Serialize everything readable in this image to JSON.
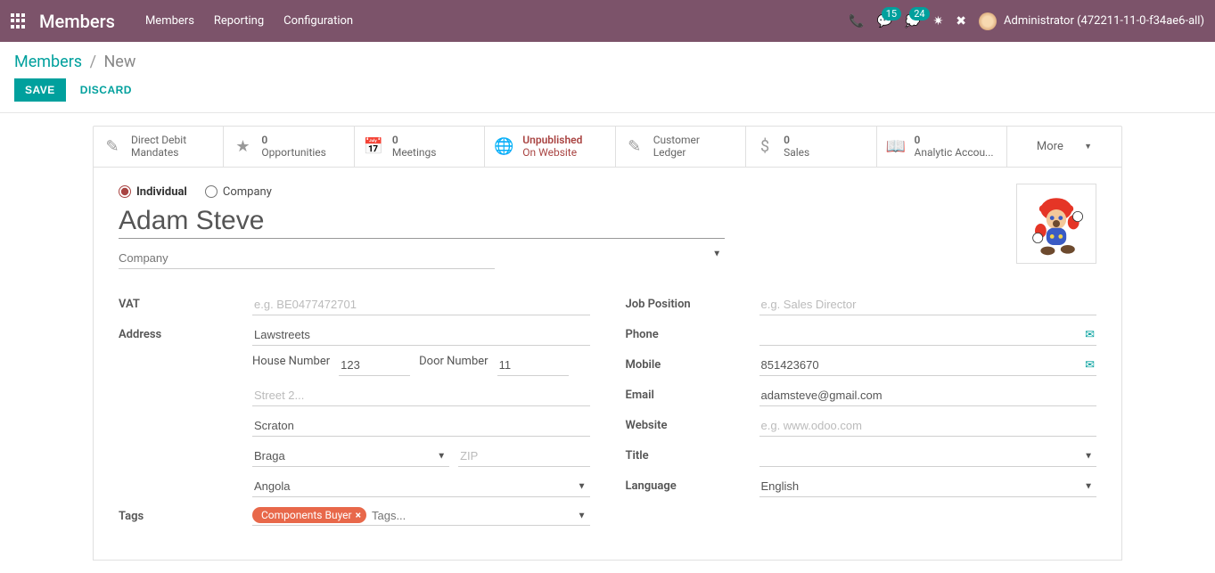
{
  "topbar": {
    "brand": "Members",
    "menu": [
      "Members",
      "Reporting",
      "Configuration"
    ],
    "badges": {
      "msgs": "15",
      "chats": "24"
    },
    "user": "Administrator (472211-11-0-f34ae6-all)"
  },
  "breadcrumb": {
    "root": "Members",
    "current": "New"
  },
  "actions": {
    "save": "SAVE",
    "discard": "DISCARD"
  },
  "stats": [
    {
      "num": "",
      "label": "Direct Debit",
      "label2": "Mandates",
      "icon": "✎"
    },
    {
      "num": "0",
      "label": "Opportunities",
      "icon": "★"
    },
    {
      "num": "0",
      "label": "Meetings",
      "icon": "📅"
    },
    {
      "num": "Unpublished",
      "label": "On Website",
      "icon": "🌐",
      "unpub": true
    },
    {
      "num": "",
      "label": "Customer",
      "label2": "Ledger",
      "icon": "✎"
    },
    {
      "num": "0",
      "label": "Sales",
      "icon": "$"
    },
    {
      "num": "0",
      "label": "Analytic Accou...",
      "icon": "📖"
    }
  ],
  "more": "More",
  "type": {
    "individual": "Individual",
    "company": "Company"
  },
  "name": "Adam Steve",
  "company_placeholder": "Company",
  "left": {
    "vat": {
      "label": "VAT",
      "placeholder": "e.g. BE0477472701",
      "value": ""
    },
    "address": {
      "label": "Address",
      "street": "Lawstreets",
      "house_lbl": "House Number",
      "house": "123",
      "door_lbl": "Door Number",
      "door": "11",
      "street2_placeholder": "Street 2...",
      "city": "Scraton",
      "state": "Braga",
      "zip_placeholder": "ZIP",
      "country": "Angola"
    },
    "tags": {
      "label": "Tags",
      "items": [
        "Components Buyer"
      ],
      "placeholder": "Tags..."
    }
  },
  "right": {
    "job": {
      "label": "Job Position",
      "placeholder": "e.g. Sales Director",
      "value": ""
    },
    "phone": {
      "label": "Phone",
      "value": ""
    },
    "mobile": {
      "label": "Mobile",
      "value": "851423670"
    },
    "email": {
      "label": "Email",
      "value": "adamsteve@gmail.com"
    },
    "website": {
      "label": "Website",
      "placeholder": "e.g. www.odoo.com",
      "value": ""
    },
    "title": {
      "label": "Title",
      "value": ""
    },
    "language": {
      "label": "Language",
      "value": "English"
    }
  }
}
